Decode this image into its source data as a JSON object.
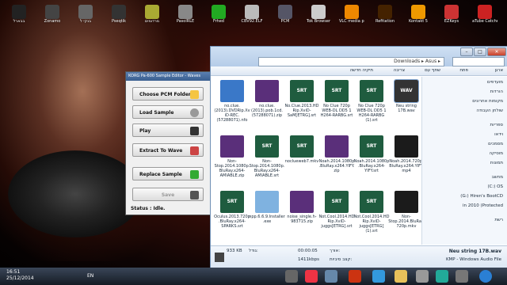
{
  "desktop_icons": [
    {
      "label": "בבארל",
      "color": "#222"
    },
    {
      "label": "Zonamo",
      "color": "#444"
    },
    {
      "label": "בנקי ל",
      "color": "#666"
    },
    {
      "label": "Pseqtik",
      "color": "#333"
    },
    {
      "label": "מרדומים",
      "color": "#aa3"
    },
    {
      "label": "PasolRLE",
      "color": "#888"
    },
    {
      "label": "Frhed",
      "color": "#2a2"
    },
    {
      "label": "CBV92.ELF",
      "color": "#bbb"
    },
    {
      "label": "PCM",
      "color": "#556"
    },
    {
      "label": "Tok Browser",
      "color": "#ccc"
    },
    {
      "label": "VLC media player",
      "color": "#e80"
    },
    {
      "label": "Refitation",
      "color": "#420"
    },
    {
      "label": "Kontakt 5",
      "color": "#e90"
    },
    {
      "label": "EZKeys",
      "color": "#c33"
    },
    {
      "label": "aTube Catcher",
      "color": "#c22"
    }
  ],
  "editor": {
    "title": "KORG Pa-600 Sample Editor - Waves",
    "choose_pcm": "Choose PCM Folder",
    "load_sample": "Load Sample",
    "play": "Play",
    "extract": "Extract To Wave",
    "replace": "Replace Sample",
    "save": "Save",
    "status_label": "Status :",
    "status_value": "Idle."
  },
  "explorer": {
    "address": "Downloads ▸ Asus ▸",
    "toolbar": {
      "organize": "ארגן",
      "open": "פתח",
      "burn": "צריבה",
      "share": "שתף עם",
      "new_folder": "תיקיה חדשה"
    },
    "files": [
      {
        "name": "no.clue.(2013).DVDRip.XviD-REC.(57288071).nfo",
        "kind": "info"
      },
      {
        "name": "no.clue.(2013).pob.1cd.(57288071).zip",
        "kind": "rar"
      },
      {
        "name": "No.Clue.2013.HDRip.XviD-SaM[ETRG].srt",
        "kind": "srt"
      },
      {
        "name": "No Clue 720p WEB-DL DD5 1 H264-RARBG.srt",
        "kind": "srt"
      },
      {
        "name": "No Clue 720p WEB-DL DD5 1 H264-RARBG (1).srt",
        "kind": "srt"
      },
      {
        "name": "Neu string 17B.wav",
        "kind": "wav"
      },
      {
        "name": "Non-Stop.2014.1080p.BluRay.x264-AMIABLE.zip",
        "kind": "rar"
      },
      {
        "name": "Non-Stop.2014.1080p.BluRay.x264-AMIABLE.srt",
        "kind": "srt"
      },
      {
        "name": "noclueweb7.mkv",
        "kind": "srt"
      },
      {
        "name": "Noah.2014.1080p.BluRay.x264.YIFY.zip",
        "kind": "rar"
      },
      {
        "name": "Noah.2014.1080p.BluRay.x264-YIFY.srt",
        "kind": "srt"
      },
      {
        "name": "Noah.2014.720p.BluRay.x264.YIFY.mp4",
        "kind": "video"
      },
      {
        "name": "Oculus.2013.720p.BluRay.x264-SPARKS.srt",
        "kind": "srt"
      },
      {
        "name": "npp.6.6.9.Installer.exe",
        "kind": "exe"
      },
      {
        "name": "noise_single.h-983715.zip",
        "kind": "rar"
      },
      {
        "name": "Not.Cool.2014.HDRip.XviD-juggs[ETRG].srt",
        "kind": "srt"
      },
      {
        "name": "Not.Cool.2014.HDRip.XviD-juggs[ETRG] (1).srt",
        "kind": "srt"
      },
      {
        "name": "Non-Stop.2014.BluRay.720p.mkv",
        "kind": "video"
      }
    ],
    "nav": [
      "מועדפים",
      "הורדות",
      "מקומות אחרונים",
      "שולחן העבודה",
      "ספריות",
      "וידאו",
      "מסמכים",
      "מוסיקה",
      "תמונות",
      "מחשב",
      "(C:) OS",
      "(G:) Hiren's BootCD",
      "in 2010 (Protected",
      "רשת"
    ],
    "details": {
      "filename": "Neu string 17B.wav",
      "type": "KMP - Windows Audio File",
      "length_label": "אורך:",
      "length": "00:00:05",
      "size_label": "גודל:",
      "size": "933 KB",
      "bitrate": "1411kbps",
      "bitrate_label": "קצב סיביות:"
    }
  },
  "taskbar": {
    "time": "16:51",
    "date": "25/12/2014",
    "lang": "EN"
  }
}
